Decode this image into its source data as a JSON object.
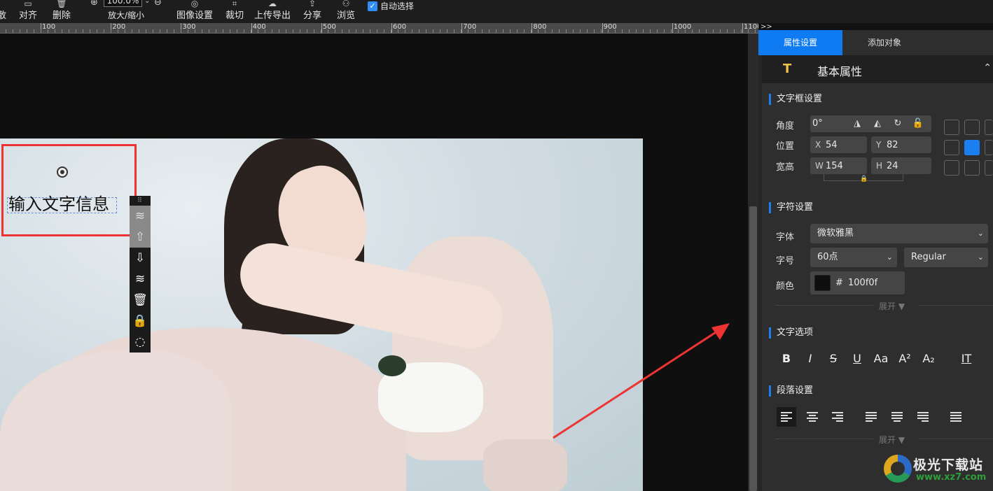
{
  "toolbar": {
    "partial_left": "散",
    "align": "对齐",
    "delete": "删除",
    "zoom_value": "100.0%",
    "zoom_label": "放大/缩小",
    "image_settings": "图像设置",
    "crop": "裁切",
    "upload_export": "上传导出",
    "share": "分享",
    "preview": "浏览",
    "auto_select": "自动选择",
    "auto_select_checked": true
  },
  "ruler": {
    "labels": [
      "100",
      "200",
      "300",
      "400",
      "500",
      "600",
      "700",
      "800",
      "900",
      "1000",
      "1100"
    ],
    "more": ">>"
  },
  "canvas": {
    "text_box": "输入文字信息",
    "side_tools": [
      "layer-up-icon",
      "move-up-icon",
      "move-down-icon",
      "layer-down-icon",
      "trash-icon",
      "lock-icon",
      "select-icon"
    ]
  },
  "panel": {
    "tabs": {
      "properties": "属性设置",
      "add_object": "添加对象"
    },
    "basic_title": "基本属性",
    "text_frame": {
      "title": "文字框设置",
      "angle_label": "角度",
      "angle_value": "0°",
      "position_label": "位置",
      "x_key": "X",
      "x_value": "54",
      "y_key": "Y",
      "y_value": "82",
      "size_label": "宽高",
      "w_key": "W",
      "w_value": "154",
      "h_key": "H",
      "h_value": "24"
    },
    "char": {
      "title": "字符设置",
      "font_label": "字体",
      "font_value": "微软雅黑",
      "size_label": "字号",
      "size_value": "60点",
      "weight_value": "Regular",
      "color_label": "颜色",
      "color_hash": "#",
      "color_value": "100f0f",
      "color_swatch": "#100f0f",
      "expand": "展开 ▼"
    },
    "text_options": {
      "title": "文字选项",
      "buttons": [
        "B",
        "I",
        "S",
        "U",
        "Aa",
        "A²",
        "A₂",
        "IT"
      ]
    },
    "paragraph": {
      "title": "段落设置",
      "expand": "展开 ▼"
    }
  },
  "watermark": {
    "name": "极光下载站",
    "url": "www.xz7.com"
  },
  "colors": {
    "accent": "#1b7ff2",
    "annotation_red": "#e33333"
  }
}
